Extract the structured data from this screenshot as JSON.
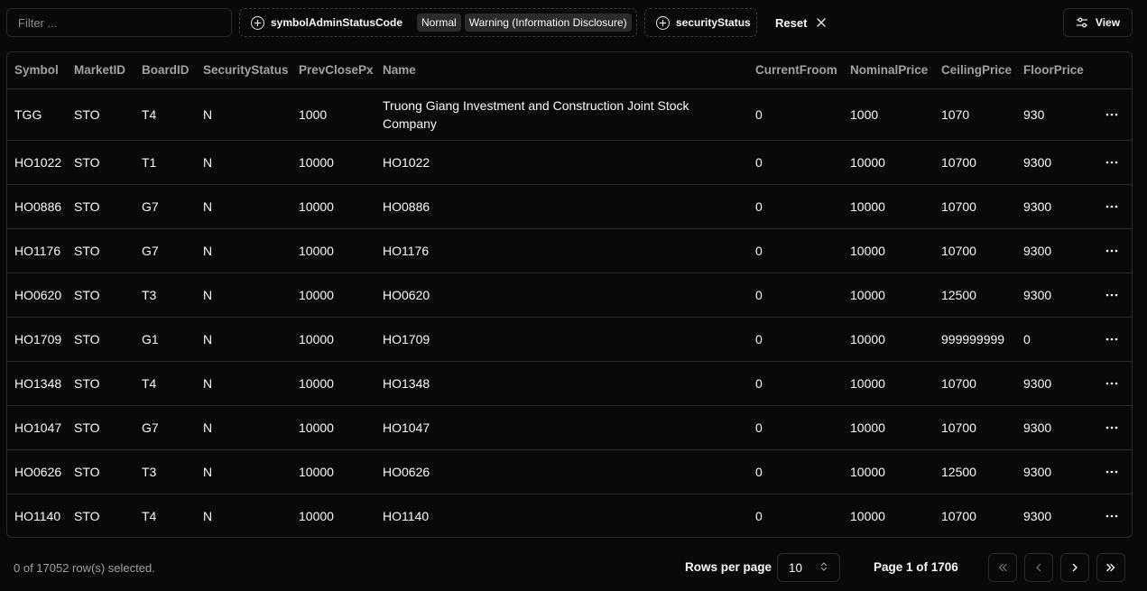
{
  "toolbar": {
    "filter_placeholder": "Filter ...",
    "facet1": {
      "label": "symbolAdminStatusCode",
      "selected": [
        "Normal",
        "Warning (Information Disclosure)"
      ]
    },
    "facet2": {
      "label": "securityStatus"
    },
    "reset_label": "Reset",
    "view_label": "View"
  },
  "table": {
    "columns": [
      "Symbol",
      "MarketID",
      "BoardID",
      "SecurityStatus",
      "PrevClosePx",
      "Name",
      "CurrentFroom",
      "NominalPrice",
      "CeilingPrice",
      "FloorPrice"
    ],
    "rows": [
      [
        "TGG",
        "STO",
        "T4",
        "N",
        "1000",
        "Truong Giang Investment and Construction Joint Stock Company",
        "0",
        "1000",
        "1070",
        "930"
      ],
      [
        "HO1022",
        "STO",
        "T1",
        "N",
        "10000",
        "HO1022",
        "0",
        "10000",
        "10700",
        "9300"
      ],
      [
        "HO0886",
        "STO",
        "G7",
        "N",
        "10000",
        "HO0886",
        "0",
        "10000",
        "10700",
        "9300"
      ],
      [
        "HO1176",
        "STO",
        "G7",
        "N",
        "10000",
        "HO1176",
        "0",
        "10000",
        "10700",
        "9300"
      ],
      [
        "HO0620",
        "STO",
        "T3",
        "N",
        "10000",
        "HO0620",
        "0",
        "10000",
        "12500",
        "9300"
      ],
      [
        "HO1709",
        "STO",
        "G1",
        "N",
        "10000",
        "HO1709",
        "0",
        "10000",
        "999999999",
        "0"
      ],
      [
        "HO1348",
        "STO",
        "T4",
        "N",
        "10000",
        "HO1348",
        "0",
        "10000",
        "10700",
        "9300"
      ],
      [
        "HO1047",
        "STO",
        "G7",
        "N",
        "10000",
        "HO1047",
        "0",
        "10000",
        "10700",
        "9300"
      ],
      [
        "HO0626",
        "STO",
        "T3",
        "N",
        "10000",
        "HO0626",
        "0",
        "10000",
        "12500",
        "9300"
      ],
      [
        "HO1140",
        "STO",
        "T4",
        "N",
        "10000",
        "HO1140",
        "0",
        "10000",
        "10700",
        "9300"
      ]
    ]
  },
  "footer": {
    "selection_text": "0 of 17052 row(s) selected.",
    "rows_per_page_label": "Rows per page",
    "rows_per_page_value": "10",
    "page_text": "Page 1 of 1706"
  },
  "icons": {
    "add": "plus-circle-icon",
    "reset": "x-icon",
    "view": "sliders-icon",
    "row_actions": "more-horizontal-icon",
    "select": "chevrons-up-down-icon",
    "pagination": [
      "chevrons-left-icon",
      "chevron-left-icon",
      "chevron-right-icon",
      "chevrons-right-icon"
    ]
  },
  "colors": {
    "background": "#0a0909",
    "border": "#2a2a2a",
    "text": "#fafafa",
    "muted_text": "#a1a1a1",
    "chip_bg": "#2b2b2b"
  }
}
